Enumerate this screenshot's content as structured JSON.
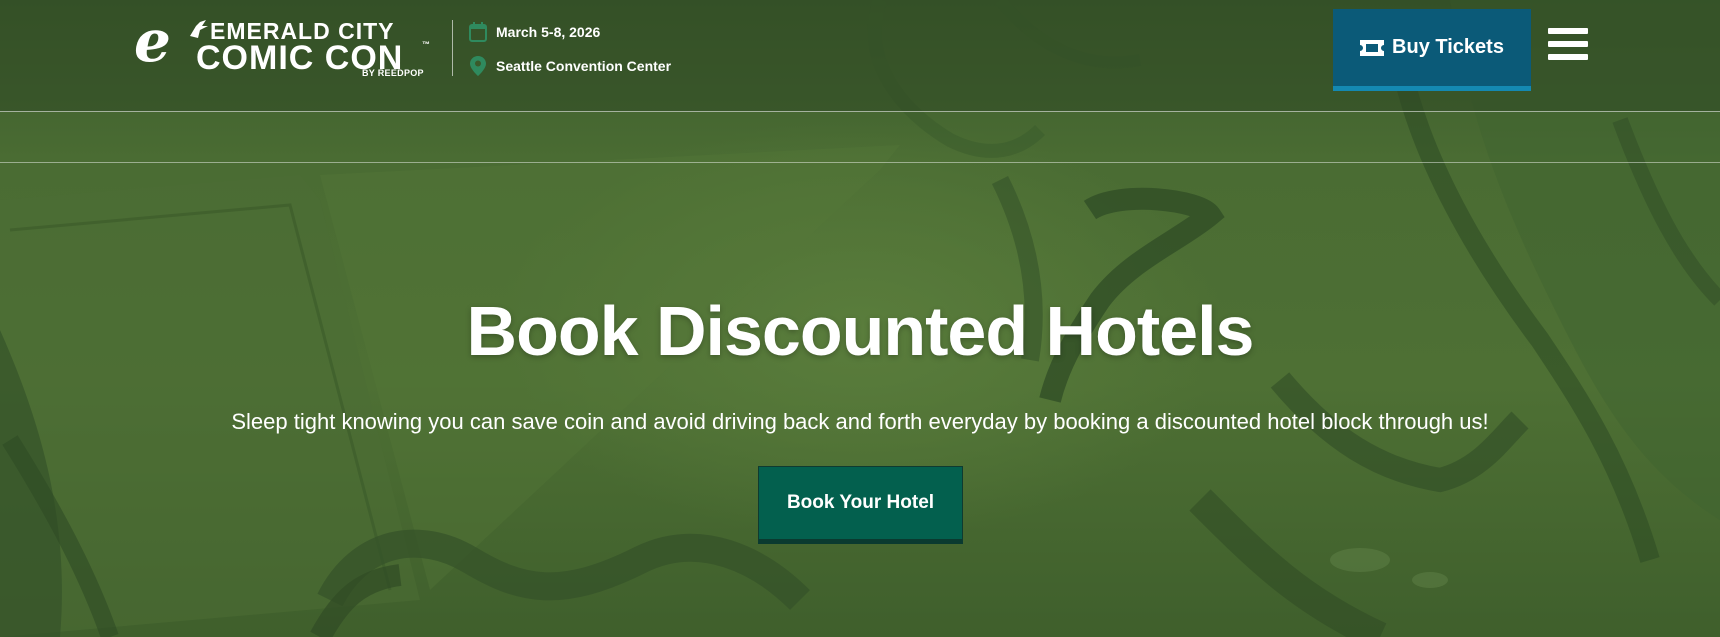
{
  "brand": {
    "line1": "EMERALD CITY",
    "line2": "COMIC CON",
    "tm": "™",
    "byline": "BY REEDPOP"
  },
  "event": {
    "dates": "March 5-8, 2026",
    "venue": "Seattle Convention Center"
  },
  "header": {
    "buy_tickets_label": "Buy Tickets",
    "menu_icon": "hamburger-menu-icon"
  },
  "hero": {
    "title": "Book Discounted Hotels",
    "subtitle": "Sleep tight knowing you can save coin and avoid driving back and forth everyday by booking a discounted hotel block through us!",
    "cta_label": "Book Your Hotel"
  },
  "colors": {
    "buy_button": "#0b5a78",
    "buy_button_underline": "#1489b2",
    "cta_button": "#03604e",
    "background": "#4b6b34",
    "icon_accent": "#2f8a5e"
  }
}
